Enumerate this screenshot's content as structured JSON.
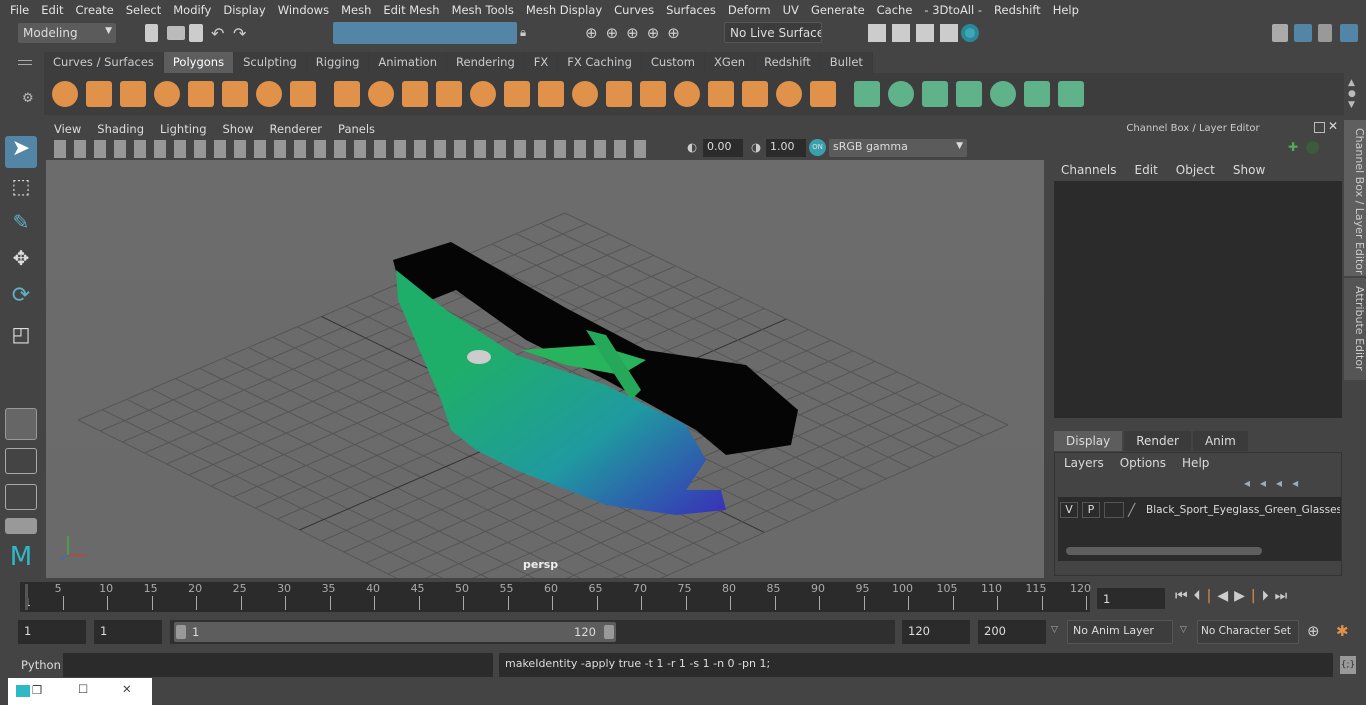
{
  "menu": [
    "File",
    "Edit",
    "Create",
    "Select",
    "Modify",
    "Display",
    "Windows",
    "Mesh",
    "Edit Mesh",
    "Mesh Tools",
    "Mesh Display",
    "Curves",
    "Surfaces",
    "Deform",
    "UV",
    "Generate",
    "Cache",
    "- 3DtoAll -",
    "Redshift",
    "Help"
  ],
  "status": {
    "workspace": "Modeling",
    "live_surface": "No Live Surface"
  },
  "shelf_tabs": [
    "Curves / Surfaces",
    "Polygons",
    "Sculpting",
    "Rigging",
    "Animation",
    "Rendering",
    "FX",
    "FX Caching",
    "Custom",
    "XGen",
    "Redshift",
    "Bullet"
  ],
  "shelf_active": "Polygons",
  "shelf_icons": [
    "poly-sphere-icon",
    "poly-cube-icon",
    "poly-cylinder-icon",
    "poly-cone-icon",
    "poly-plane-icon",
    "poly-torus-icon",
    "poly-pyramid-icon",
    "poly-pipe-icon",
    "combine-icon",
    "separate-icon",
    "mirror-icon",
    "smooth-icon",
    "bevel-icon",
    "extrude-icon",
    "multi-cut-icon",
    "bridge-icon",
    "append-icon",
    "fill-hole-icon",
    "insert-edge-loop-icon",
    "wedge-icon",
    "merge-icon",
    "triangulate-icon",
    "quadrangulate-icon",
    "planar-uv-icon",
    "cylindrical-uv-icon",
    "spherical-uv-icon",
    "automatic-uv-icon",
    "unfold-uv-icon",
    "uv-editor-icon",
    "uv-layout-icon"
  ],
  "viewport": {
    "menu": [
      "View",
      "Shading",
      "Lighting",
      "Show",
      "Renderer",
      "Panels"
    ],
    "exposure": "0.00",
    "gamma": "1.00",
    "color_space": "sRGB gamma",
    "camera": "persp"
  },
  "channel_box": {
    "title": "Channel Box / Layer Editor",
    "menu": [
      "Channels",
      "Edit",
      "Object",
      "Show"
    ]
  },
  "layer_editor": {
    "tabs": [
      "Display",
      "Render",
      "Anim"
    ],
    "active_tab": "Display",
    "menu": [
      "Layers",
      "Options",
      "Help"
    ],
    "layer": {
      "v": "V",
      "p": "P",
      "name": "Black_Sport_Eyeglass_Green_Glasses_"
    }
  },
  "side_tabs": [
    "Channel Box / Layer Editor",
    "Attribute Editor"
  ],
  "timeline": {
    "ticks": [
      5,
      10,
      15,
      20,
      25,
      30,
      35,
      40,
      45,
      50,
      55,
      60,
      65,
      70,
      75,
      80,
      85,
      90,
      95,
      100,
      105,
      110,
      115,
      120
    ],
    "start_label": "1",
    "current_frame": "1",
    "min": 1,
    "max": 120
  },
  "range": {
    "start": "1",
    "inner_start": "1",
    "slider_start": "1",
    "slider_end": "120",
    "end": "120",
    "max": "200",
    "anim_layer": "No Anim Layer",
    "character_set": "No Character Set"
  },
  "command": {
    "language": "Python",
    "input": "",
    "output": "makeIdentity -apply true -t 1 -r 1 -s 1 -n 0 -pn 1;"
  },
  "colors": {
    "accent": "#5285a6",
    "shelf_orange": "#e0914a",
    "shelf_green": "#5fb28a",
    "lens_green": "#1fae6a",
    "lens_blue": "#2e3fb8"
  }
}
